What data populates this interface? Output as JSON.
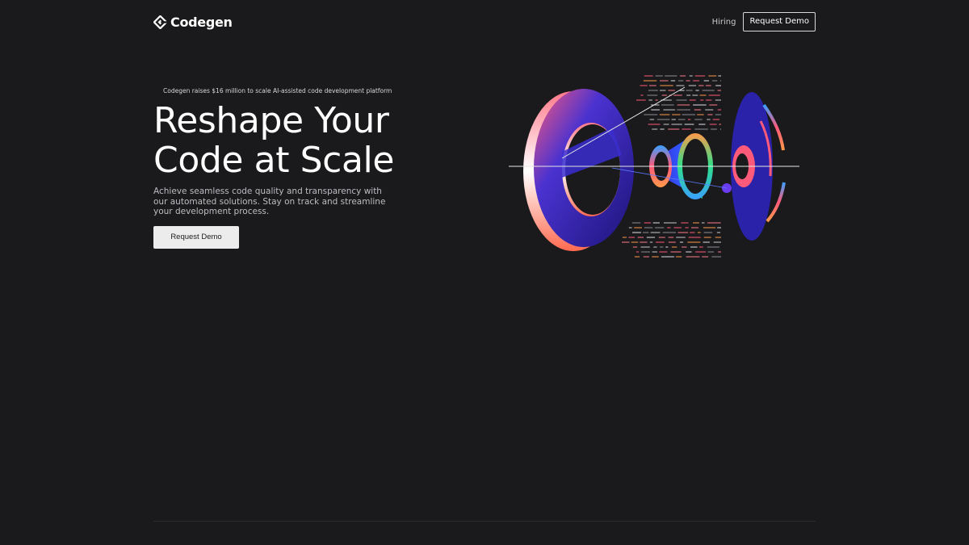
{
  "header": {
    "logo_text": "Codegen",
    "logo_icon": "codegen-diamond-icon",
    "nav": {
      "hiring_label": "Hiring",
      "request_demo_label": "Request Demo"
    }
  },
  "hero": {
    "announcement": "Codegen raises $16 million to scale AI-assisted code development platform",
    "headline": "Reshape Your\nCode at Scale",
    "subtext": "Achieve seamless code quality and transparency with our automated solutions. Stay on track and streamline your development process.",
    "cta_label": "Request Demo"
  },
  "illustration": {
    "icon": "abstract-rings-illustration",
    "colors": {
      "ring_main": "#3a25b8",
      "ring_dark": "#1c1478",
      "accent_pink": "#ff5a7a",
      "accent_orange": "#ff9a4a",
      "accent_green": "#2ee08a",
      "accent_blue": "#3aa0ff",
      "background": "#1a191b"
    }
  }
}
